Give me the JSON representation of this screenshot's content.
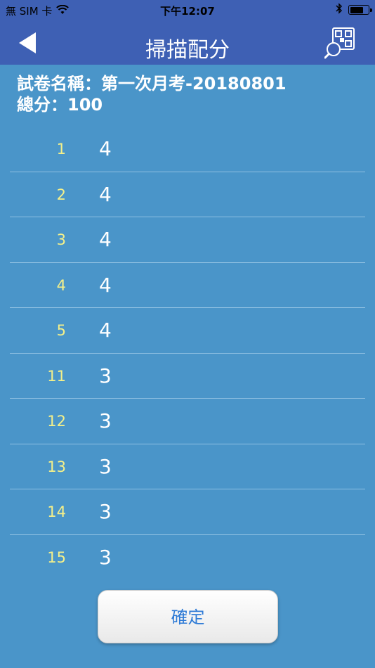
{
  "status_bar": {
    "carrier": "無 SIM 卡",
    "time": "下午12:07",
    "battery_level": 0.75
  },
  "nav": {
    "title": "掃描配分",
    "back_icon": "back-arrow-icon",
    "right_icon": "qr-search-icon"
  },
  "info": {
    "exam_name": "試卷名稱：第一次月考-20180801",
    "total_score": "總分：100"
  },
  "score_rows": [
    {
      "number": "1",
      "score": "4"
    },
    {
      "number": "2",
      "score": "4"
    },
    {
      "number": "3",
      "score": "4"
    },
    {
      "number": "4",
      "score": "4"
    },
    {
      "number": "5",
      "score": "4"
    },
    {
      "number": "11",
      "score": "3"
    },
    {
      "number": "12",
      "score": "3"
    },
    {
      "number": "13",
      "score": "3"
    },
    {
      "number": "14",
      "score": "3"
    },
    {
      "number": "15",
      "score": "3"
    }
  ],
  "confirm_label": "確定",
  "colors": {
    "nav_background": "#3e60b4",
    "page_background": "#4a95c9",
    "question_number": "#f4f08a",
    "button_text": "#2f7bd6"
  }
}
